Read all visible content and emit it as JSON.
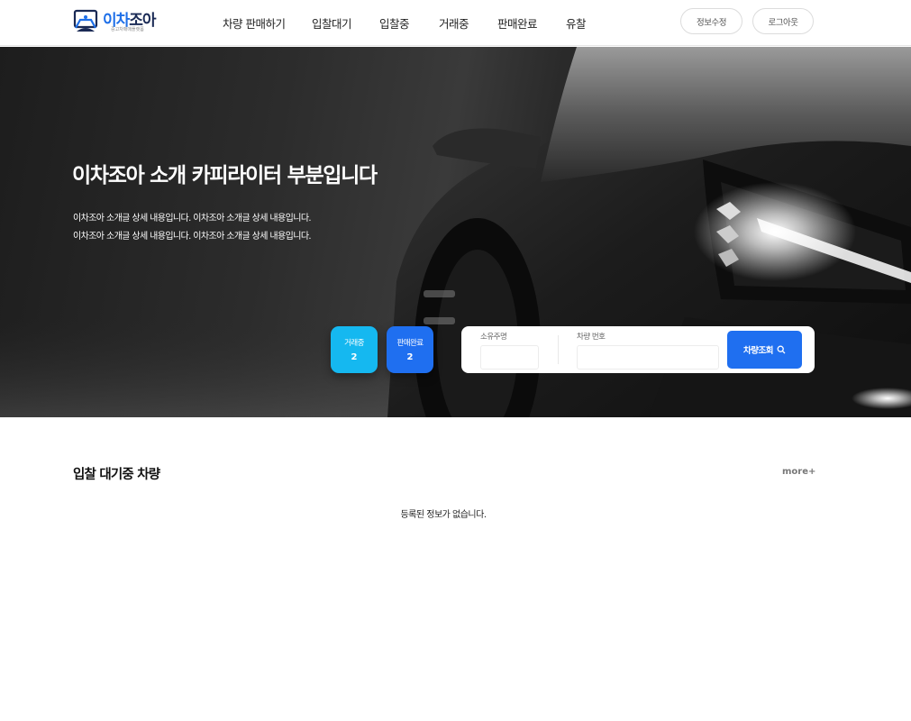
{
  "logo": {
    "text_a": "이차",
    "text_b": "조아",
    "sub": "중고차매매플랫폼"
  },
  "nav": {
    "items": [
      "차량 판매하기",
      "입찰대기",
      "입찰중",
      "거래중",
      "판매완료",
      "유찰"
    ]
  },
  "header_buttons": {
    "edit": "정보수정",
    "logout": "로그아웃"
  },
  "hero": {
    "title": "이차조아 소개 카피라이터 부분입니다",
    "desc_line1": "이차조아 소개글 상세 내용입니다. 이차조아 소개글 상세 내용입니다.",
    "desc_line2": "이차조아 소개글 상세 내용입니다. 이차조아 소개글 상세 내용입니다."
  },
  "stats": [
    {
      "label": "거래중",
      "value": "2",
      "color": "#15b8f0"
    },
    {
      "label": "판매완료",
      "value": "2",
      "color": "#1f6ff0"
    }
  ],
  "search": {
    "owner_label": "소유주명",
    "owner_value": "",
    "plate_label": "차량 번호",
    "plate_value": "",
    "button": "차량조회",
    "button_icon": "search-icon"
  },
  "section": {
    "title": "입찰 대기중 차량",
    "more": "more+",
    "empty": "등록된 정보가 없습니다."
  },
  "colors": {
    "primary": "#1f6ff0",
    "cyan": "#15b8f0"
  }
}
